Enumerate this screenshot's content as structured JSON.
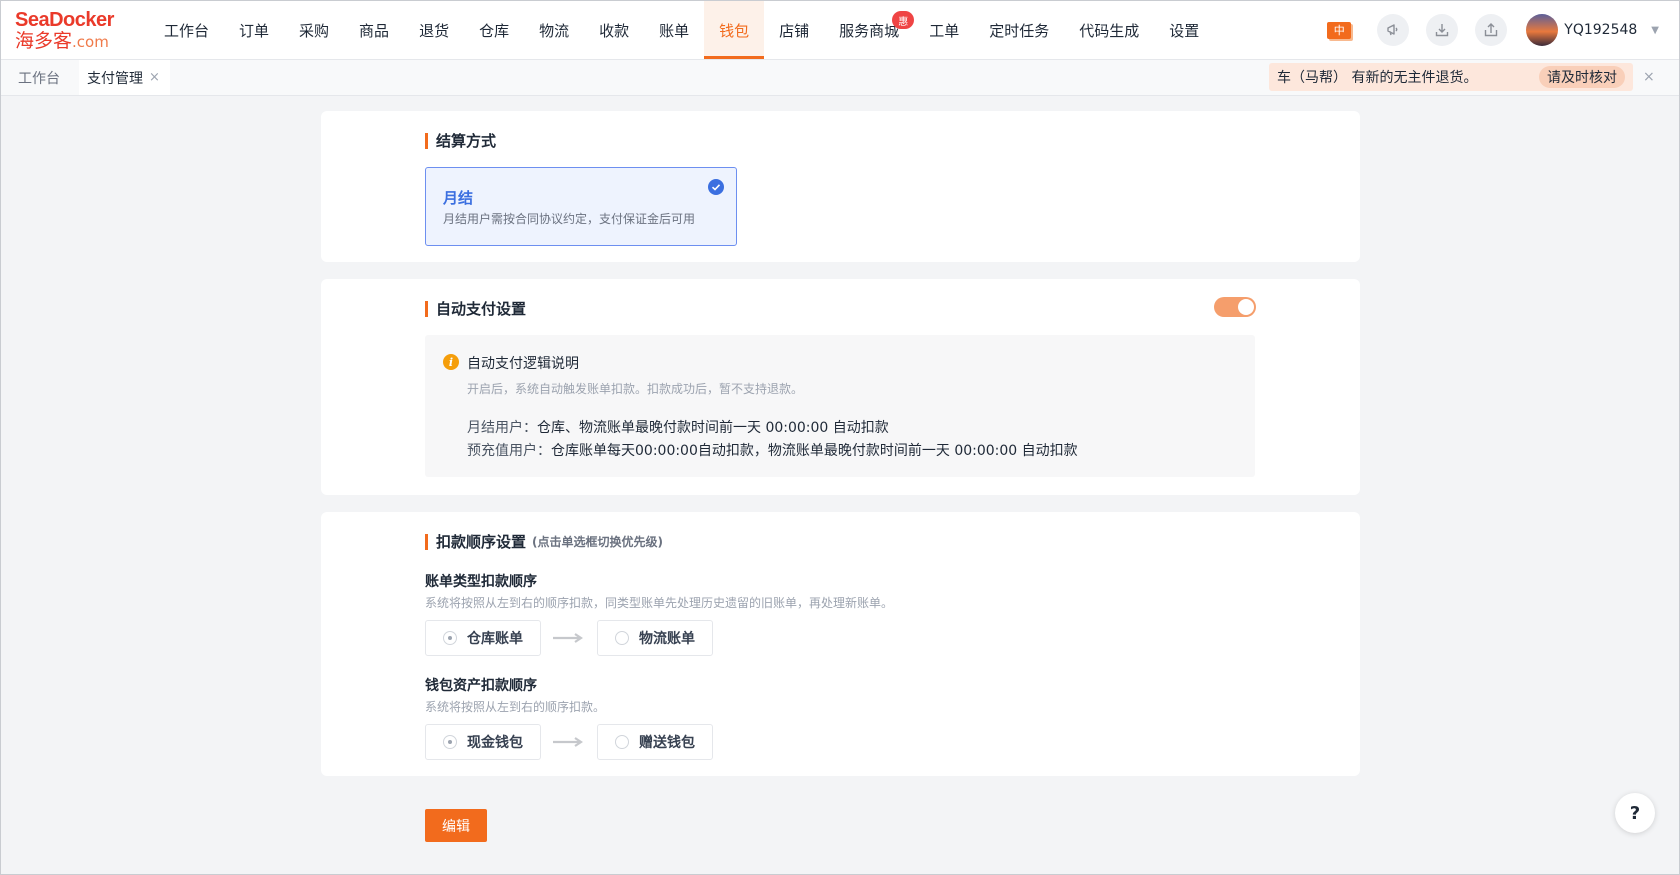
{
  "logo": {
    "brand": "SeaDocker",
    "cn": "海多客",
    "domain": ".com"
  },
  "nav": {
    "items": [
      {
        "label": "工作台"
      },
      {
        "label": "订单"
      },
      {
        "label": "采购"
      },
      {
        "label": "商品"
      },
      {
        "label": "退货"
      },
      {
        "label": "仓库"
      },
      {
        "label": "物流"
      },
      {
        "label": "收款"
      },
      {
        "label": "账单"
      },
      {
        "label": "钱包",
        "active": true
      },
      {
        "label": "店铺"
      },
      {
        "label": "服务商城",
        "badge": "惠"
      },
      {
        "label": "工单"
      },
      {
        "label": "定时任务"
      },
      {
        "label": "代码生成"
      },
      {
        "label": "设置"
      }
    ],
    "lang": "中",
    "username": "YQ192548",
    "accent": "#f26b1d"
  },
  "tabs": {
    "items": [
      "工作台",
      "支付管理"
    ],
    "close": "×"
  },
  "notice": {
    "text": "车（马帮） 有新的无主件退货。",
    "action": "请及时核对",
    "close": "×"
  },
  "settlement": {
    "title": "结算方式",
    "option_title": "月结",
    "option_desc": "月结用户需按合同协议约定，支付保证金后可用"
  },
  "autopay": {
    "title": "自动支付设置",
    "enabled": true,
    "info_title": "自动支付逻辑说明",
    "info_sub": "开启后，系统自动触发账单扣款。扣款成功后，暂不支持退款。",
    "row1_label": "月结用户：",
    "row1_text": "仓库、物流账单最晚付款时间前一天 00:00:00 自动扣款",
    "row2_label": "预充值用户：",
    "row2_text": "仓库账单每天00:00:00自动扣款，物流账单最晚付款时间前一天 00:00:00 自动扣款"
  },
  "deduction": {
    "title": "扣款顺序设置",
    "hint": "(点击单选框切换优先级)",
    "bill": {
      "title": "账单类型扣款顺序",
      "desc": "系统将按照从左到右的顺序扣款，同类型账单先处理历史遗留的旧账单，再处理新账单。",
      "first": "仓库账单",
      "second": "物流账单"
    },
    "wallet": {
      "title": "钱包资产扣款顺序",
      "desc": "系统将按照从左到右的顺序扣款。",
      "first": "现金钱包",
      "second": "赠送钱包"
    }
  },
  "edit_label": "编辑",
  "help_label": "?"
}
